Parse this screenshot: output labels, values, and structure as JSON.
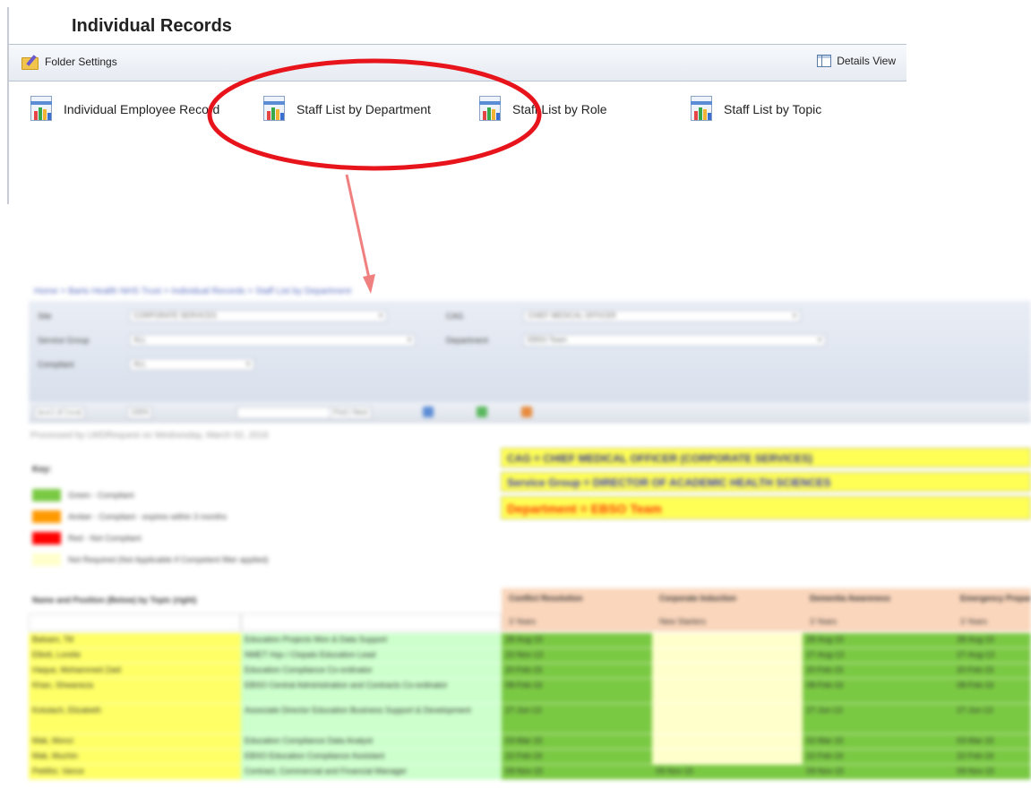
{
  "panel": {
    "title": "Individual Records",
    "toolbar": {
      "folder_settings_label": "Folder Settings",
      "details_view_label": "Details View"
    },
    "reports": [
      {
        "label": "Individual Employee Record",
        "icon": "report-icon"
      },
      {
        "label": "Staff List by Department",
        "icon": "report-icon"
      },
      {
        "label": "Staff List by Role",
        "icon": "report-icon"
      },
      {
        "label": "Staff List by Topic",
        "icon": "report-icon"
      }
    ]
  },
  "annotation": {
    "ellipse_color": "#e8141c",
    "arrow_color": "#f08080",
    "highlighted_item": "Staff List by Department"
  },
  "preview": {
    "breadcrumb": "Home > Barts Health NHS Trust > Individual Records > Staff List by Department",
    "filters": {
      "site_label": "Site",
      "site_value": "CORPORATE SERVICES",
      "cag_label": "CAG",
      "cag_value": "CHIEF MEDICAL OFFICER",
      "service_group_label": "Service Group",
      "service_group_value": "ALL",
      "department_label": "Department",
      "department_value": "EBSO Team",
      "compliant_label": "Compliant",
      "compliant_value": "ALL"
    },
    "toolbar": {
      "pager": "|◂  ◂  1  of 1  ▸  ▸|",
      "zoom": "100%",
      "find": "Find | Next"
    },
    "processed_text": "Processed by LWDRequest on Wednesday, March 02, 2016",
    "key": {
      "title": "Key:",
      "items": [
        {
          "color": "#7ac943",
          "label": "Green - Compliant"
        },
        {
          "color": "#ff9900",
          "label": "Amber - Compliant - expires within 3 months"
        },
        {
          "color": "#ff0000",
          "label": "Red - Not Compliant"
        },
        {
          "color": "#ffffcc",
          "label": "Not Required (Not Applicable if Competent filter applied)"
        }
      ]
    },
    "banners": [
      {
        "text": "CAG = CHIEF MEDICAL OFFICER (CORPORATE SERVICES)",
        "color": "#333399"
      },
      {
        "text": "Service Group = DIRECTOR OF ACADEMIC HEALTH SCIENCES",
        "color": "#3333cc"
      },
      {
        "text": "Department = EBSO Team",
        "color": "#ff3300"
      }
    ],
    "table": {
      "name_header": "Name and Position (Below) by Topic (right)",
      "topics": [
        {
          "name": "Conflict Resolution",
          "freq": "3 Years"
        },
        {
          "name": "Corporate Induction",
          "freq": "New Starters"
        },
        {
          "name": "Dementia Awareness",
          "freq": "3 Years"
        },
        {
          "name": "Emergency Preparedness",
          "freq": "3 Years"
        }
      ],
      "rows": [
        {
          "name": "Balsam, Till",
          "role": "Education Projects Mon & Data Support",
          "cells": [
            "28-Aug-15",
            "",
            "28-Aug-15",
            "28-Aug-15"
          ]
        },
        {
          "name": "Elliott, Lorelie",
          "role": "NMET Hqs / Clopals Education Lead",
          "cells": [
            "22-Nov-13",
            "",
            "27-Aug-13",
            "27-Aug-13"
          ]
        },
        {
          "name": "Haque, Mohammed Zaid",
          "role": "Education Compliance Co-ordinator",
          "cells": [
            "20-Feb-15",
            "",
            "20-Feb-15",
            "20-Feb-15"
          ]
        },
        {
          "name": "Khan, Shwaneza",
          "role": "EBSO Central Administration and Contracts Co-ordinator",
          "cells": [
            "08-Feb-16",
            "",
            "08-Feb-16",
            "08-Feb-16"
          ]
        },
        {
          "name": "Kotulach, Elizabeth",
          "role": "Associate Director Education Business Support & Development",
          "cells": [
            "27-Jun-13",
            "",
            "27-Jun-13",
            "27-Jun-13"
          ]
        },
        {
          "name": "Mak, Monci",
          "role": "Education Compliance Data Analyst",
          "cells": [
            "03-Mar-15",
            "",
            "02-Mar-15",
            "03-Mar-15"
          ]
        },
        {
          "name": "Mak, Muchin",
          "role": "EBSO Education Compliance Assistant",
          "cells": [
            "22-Feb-16",
            "",
            "22-Feb-16",
            "22-Feb-16"
          ]
        },
        {
          "name": "Pettifor, Vance",
          "role": "Contract, Commercial and Financial Manager",
          "cells": [
            "09-Nov-15",
            "09-Nov-15",
            "09-Nov-15",
            "09-Nov-15"
          ]
        }
      ]
    }
  }
}
